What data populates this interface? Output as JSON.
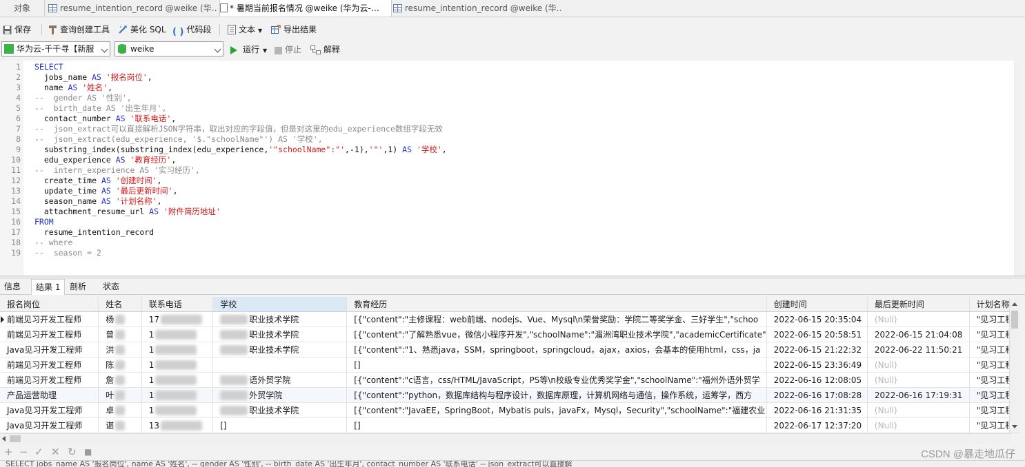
{
  "tabs": {
    "objects_label": "对象",
    "tab1": "resume_intention_record @weike (华…",
    "tab2": "* 暑期当前报名情况 @weike (华为云-…",
    "tab3": "resume_intention_record @weike (华…"
  },
  "toolbar": {
    "save": "保存",
    "query_builder": "查询创建工具",
    "beautify": "美化 SQL",
    "snippet": "代码段",
    "text": "文本",
    "export": "导出结果"
  },
  "toolbar2": {
    "connection": "华为云-千千寻【新服",
    "database": "weike",
    "run": "运行",
    "stop": "停止",
    "explain": "解释"
  },
  "editor": {
    "lines": [
      {
        "n": "1",
        "parts": [
          {
            "c": "kw",
            "t": "SELECT"
          }
        ]
      },
      {
        "n": "2",
        "parts": [
          {
            "c": "id",
            "t": "  jobs_name "
          },
          {
            "c": "kw",
            "t": "AS "
          },
          {
            "c": "str",
            "t": "'报名岗位'"
          },
          {
            "c": "id",
            "t": ","
          }
        ]
      },
      {
        "n": "3",
        "parts": [
          {
            "c": "id",
            "t": "  name "
          },
          {
            "c": "kw",
            "t": "AS "
          },
          {
            "c": "str",
            "t": "'姓名'"
          },
          {
            "c": "id",
            "t": ","
          }
        ]
      },
      {
        "n": "4",
        "parts": [
          {
            "c": "cmt",
            "t": "--  gender AS '性别',"
          }
        ]
      },
      {
        "n": "5",
        "parts": [
          {
            "c": "cmt",
            "t": "--  birth_date AS '出生年月',"
          }
        ]
      },
      {
        "n": "6",
        "parts": [
          {
            "c": "id",
            "t": "  contact_number "
          },
          {
            "c": "kw",
            "t": "AS "
          },
          {
            "c": "str",
            "t": "'联系电话'"
          },
          {
            "c": "id",
            "t": ","
          }
        ]
      },
      {
        "n": "7",
        "parts": [
          {
            "c": "cmt",
            "t": "--  json_extract可以直接解析JSON字符串，取出对应的字段值，但是对这里的edu_experience数组字段无效"
          }
        ]
      },
      {
        "n": "8",
        "parts": [
          {
            "c": "cmt",
            "t": "--  json_extract(edu_experience, '$.\"schoolName\"') AS '学校',"
          }
        ]
      },
      {
        "n": "9",
        "parts": [
          {
            "c": "id",
            "t": "  substring_index(substring_index(edu_experience,"
          },
          {
            "c": "str",
            "t": "'\"schoolName\":\"'"
          },
          {
            "c": "id",
            "t": ",-1),"
          },
          {
            "c": "str",
            "t": "'\"'"
          },
          {
            "c": "id",
            "t": ",1) "
          },
          {
            "c": "kw",
            "t": "AS "
          },
          {
            "c": "str",
            "t": "'学校'"
          },
          {
            "c": "id",
            "t": ","
          }
        ]
      },
      {
        "n": "10",
        "parts": [
          {
            "c": "id",
            "t": "  edu_experience "
          },
          {
            "c": "kw",
            "t": "AS "
          },
          {
            "c": "str",
            "t": "'教育经历'"
          },
          {
            "c": "id",
            "t": ","
          }
        ]
      },
      {
        "n": "11",
        "parts": [
          {
            "c": "cmt",
            "t": "--  intern_experience AS '实习经历',"
          }
        ]
      },
      {
        "n": "12",
        "parts": [
          {
            "c": "id",
            "t": "  create_time "
          },
          {
            "c": "kw",
            "t": "AS "
          },
          {
            "c": "str",
            "t": "'创建时间'"
          },
          {
            "c": "id",
            "t": ","
          }
        ]
      },
      {
        "n": "13",
        "parts": [
          {
            "c": "id",
            "t": "  update_time "
          },
          {
            "c": "kw",
            "t": "AS "
          },
          {
            "c": "str",
            "t": "'最后更新时间'"
          },
          {
            "c": "id",
            "t": ","
          }
        ]
      },
      {
        "n": "14",
        "parts": [
          {
            "c": "id",
            "t": "  season_name "
          },
          {
            "c": "kw",
            "t": "AS "
          },
          {
            "c": "str",
            "t": "'计划名称'"
          },
          {
            "c": "id",
            "t": ","
          }
        ]
      },
      {
        "n": "15",
        "parts": [
          {
            "c": "id",
            "t": "  attachment_resume_url "
          },
          {
            "c": "kw",
            "t": "AS "
          },
          {
            "c": "str",
            "t": "'附件简历地址'"
          }
        ]
      },
      {
        "n": "16",
        "parts": [
          {
            "c": "kw",
            "t": "FROM"
          }
        ]
      },
      {
        "n": "17",
        "parts": [
          {
            "c": "id",
            "t": "  resume_intention_record"
          }
        ]
      },
      {
        "n": "18",
        "parts": [
          {
            "c": "cmt",
            "t": "-- where"
          }
        ]
      },
      {
        "n": "19",
        "parts": [
          {
            "c": "cmt",
            "t": "--  season = 2"
          }
        ]
      }
    ]
  },
  "result_tabs": [
    "信息",
    "结果 1",
    "剖析",
    "状态"
  ],
  "grid": {
    "columns": [
      "报名岗位",
      "姓名",
      "联系电话",
      "学校",
      "教育经历",
      "创建时间",
      "最后更新时间",
      "计划名称"
    ],
    "rows": [
      [
        "前端见习开发工程师",
        "杨",
        "17",
        "职业技术学院",
        "[{\"content\":\"主修课程：web前端、nodejs、Vue、Mysql\\n荣誉奖励：学院二等奖学金、三好学生\",\"schoo",
        "2022-06-15 20:35:04",
        "(Null)",
        "\"见习工程"
      ],
      [
        "前端见习开发工程师",
        "曾",
        "1",
        "职业技术学院",
        "[{\"content\":\"了解熟悉vue，微信小程序开发\",\"schoolName\":\"湄洲湾职业技术学院\",\"academicCertificate\"",
        "2022-06-15 20:58:51",
        "2022-06-15 21:04:08",
        "\"见习工程"
      ],
      [
        "Java见习开发工程师",
        "洪",
        "1",
        "职业技术学院",
        "[{\"content\":\"1、熟悉java，SSM，springboot，springcloud，ajax，axios，会基本的使用html，css，ja",
        "2022-06-15 21:22:32",
        "2022-06-22 11:50:21",
        "\"见习工程"
      ],
      [
        "前端见习开发工程师",
        "陈",
        "1",
        "",
        "[]",
        "2022-06-15 23:36:49",
        "(Null)",
        "\"见习工程"
      ],
      [
        "前端见习开发工程师",
        "詹",
        "1",
        "语外贸学院",
        "[{\"content\":\"c语言，css/HTML/JavaScript，PS等\\n校级专业优秀奖学金\",\"schoolName\":\"福州外语外贸学",
        "2022-06-16 12:08:05",
        "(Null)",
        "\"见习工程"
      ],
      [
        "产品运营助理",
        "叶",
        "1",
        "外贸学院",
        "[{\"content\":\"python，数据库结构与程序设计，数据库原理，计算机网络与通信，操作系统，运筹学，西方",
        "2022-06-16 17:08:28",
        "2022-06-16 17:19:31",
        "\"见习工程"
      ],
      [
        "Java见习开发工程师",
        "卓",
        "1",
        "职业技术学院",
        "[{\"content\":\"JavaEE，SpringBoot，Mybatis puls，javaFx，Mysql，Security\",\"schoolName\":\"福建农业",
        "2022-06-16 21:31:35",
        "(Null)",
        "\"见习工程"
      ],
      [
        "Java见习开发工程师",
        "谌",
        "13",
        "[]",
        "[]",
        "2022-06-17 12:37:20",
        "(Null)",
        "\"见习工程"
      ]
    ]
  },
  "statusbar": {
    "text": "SELECT  jobs_name  AS '报名岗位',   name  AS '姓名', -- gender  AS '性别', -- birth_date  AS '出生年月',  contact_number  AS '联系电话'  -- json_extract可以直接解"
  },
  "watermark": "CSDN @暴走地瓜仔"
}
